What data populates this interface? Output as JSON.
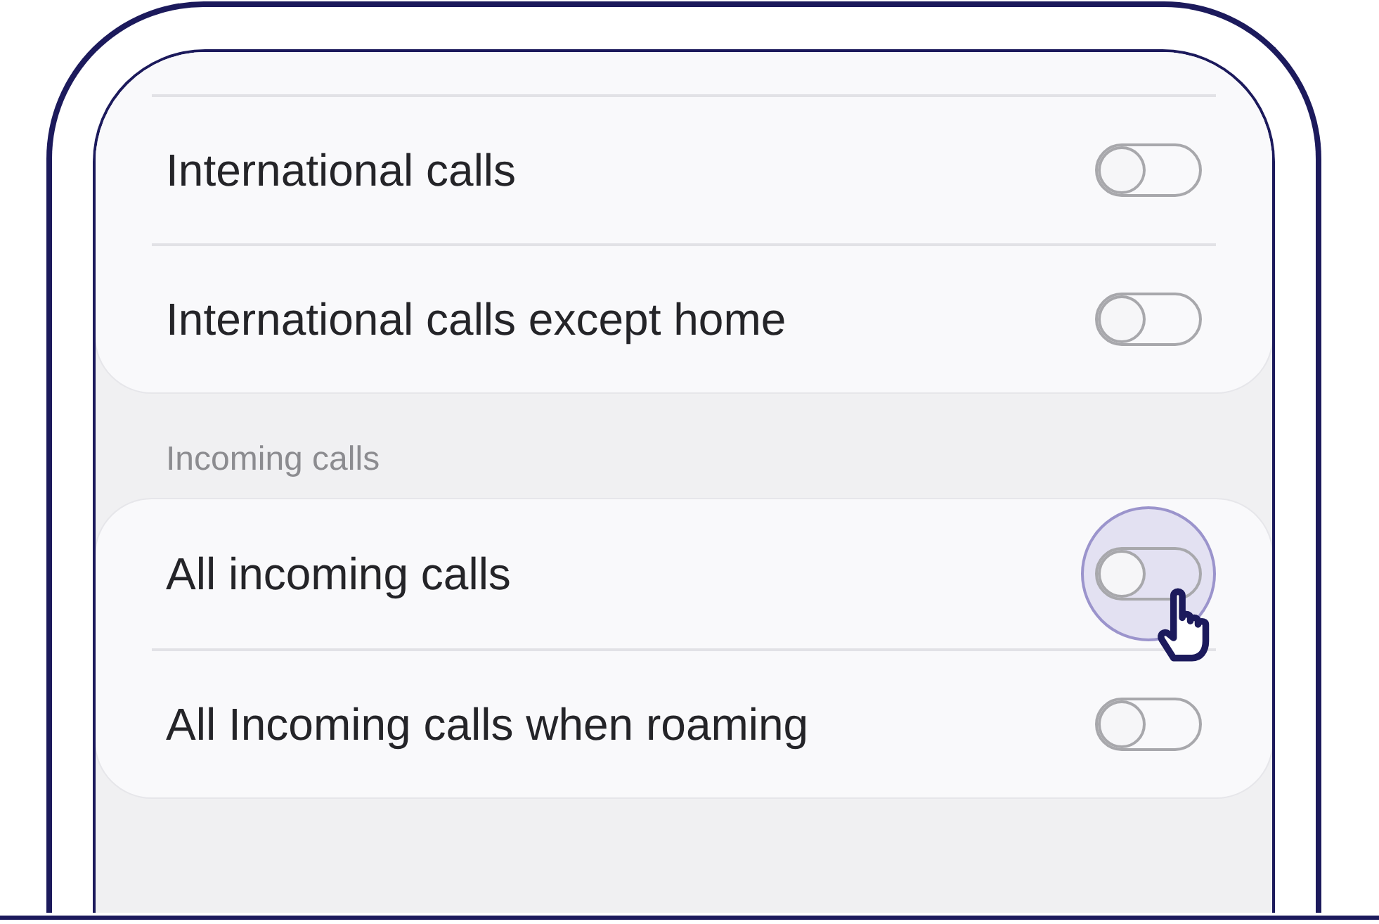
{
  "cards": [
    {
      "rows": [
        {
          "label": "International calls",
          "on": false,
          "pressed": false
        },
        {
          "label": "International calls except home",
          "on": false,
          "pressed": false
        }
      ]
    },
    {
      "header": "Incoming calls",
      "rows": [
        {
          "label": "All incoming calls",
          "on": false,
          "pressed": true
        },
        {
          "label": "All Incoming calls when roaming",
          "on": false,
          "pressed": false
        }
      ]
    }
  ]
}
